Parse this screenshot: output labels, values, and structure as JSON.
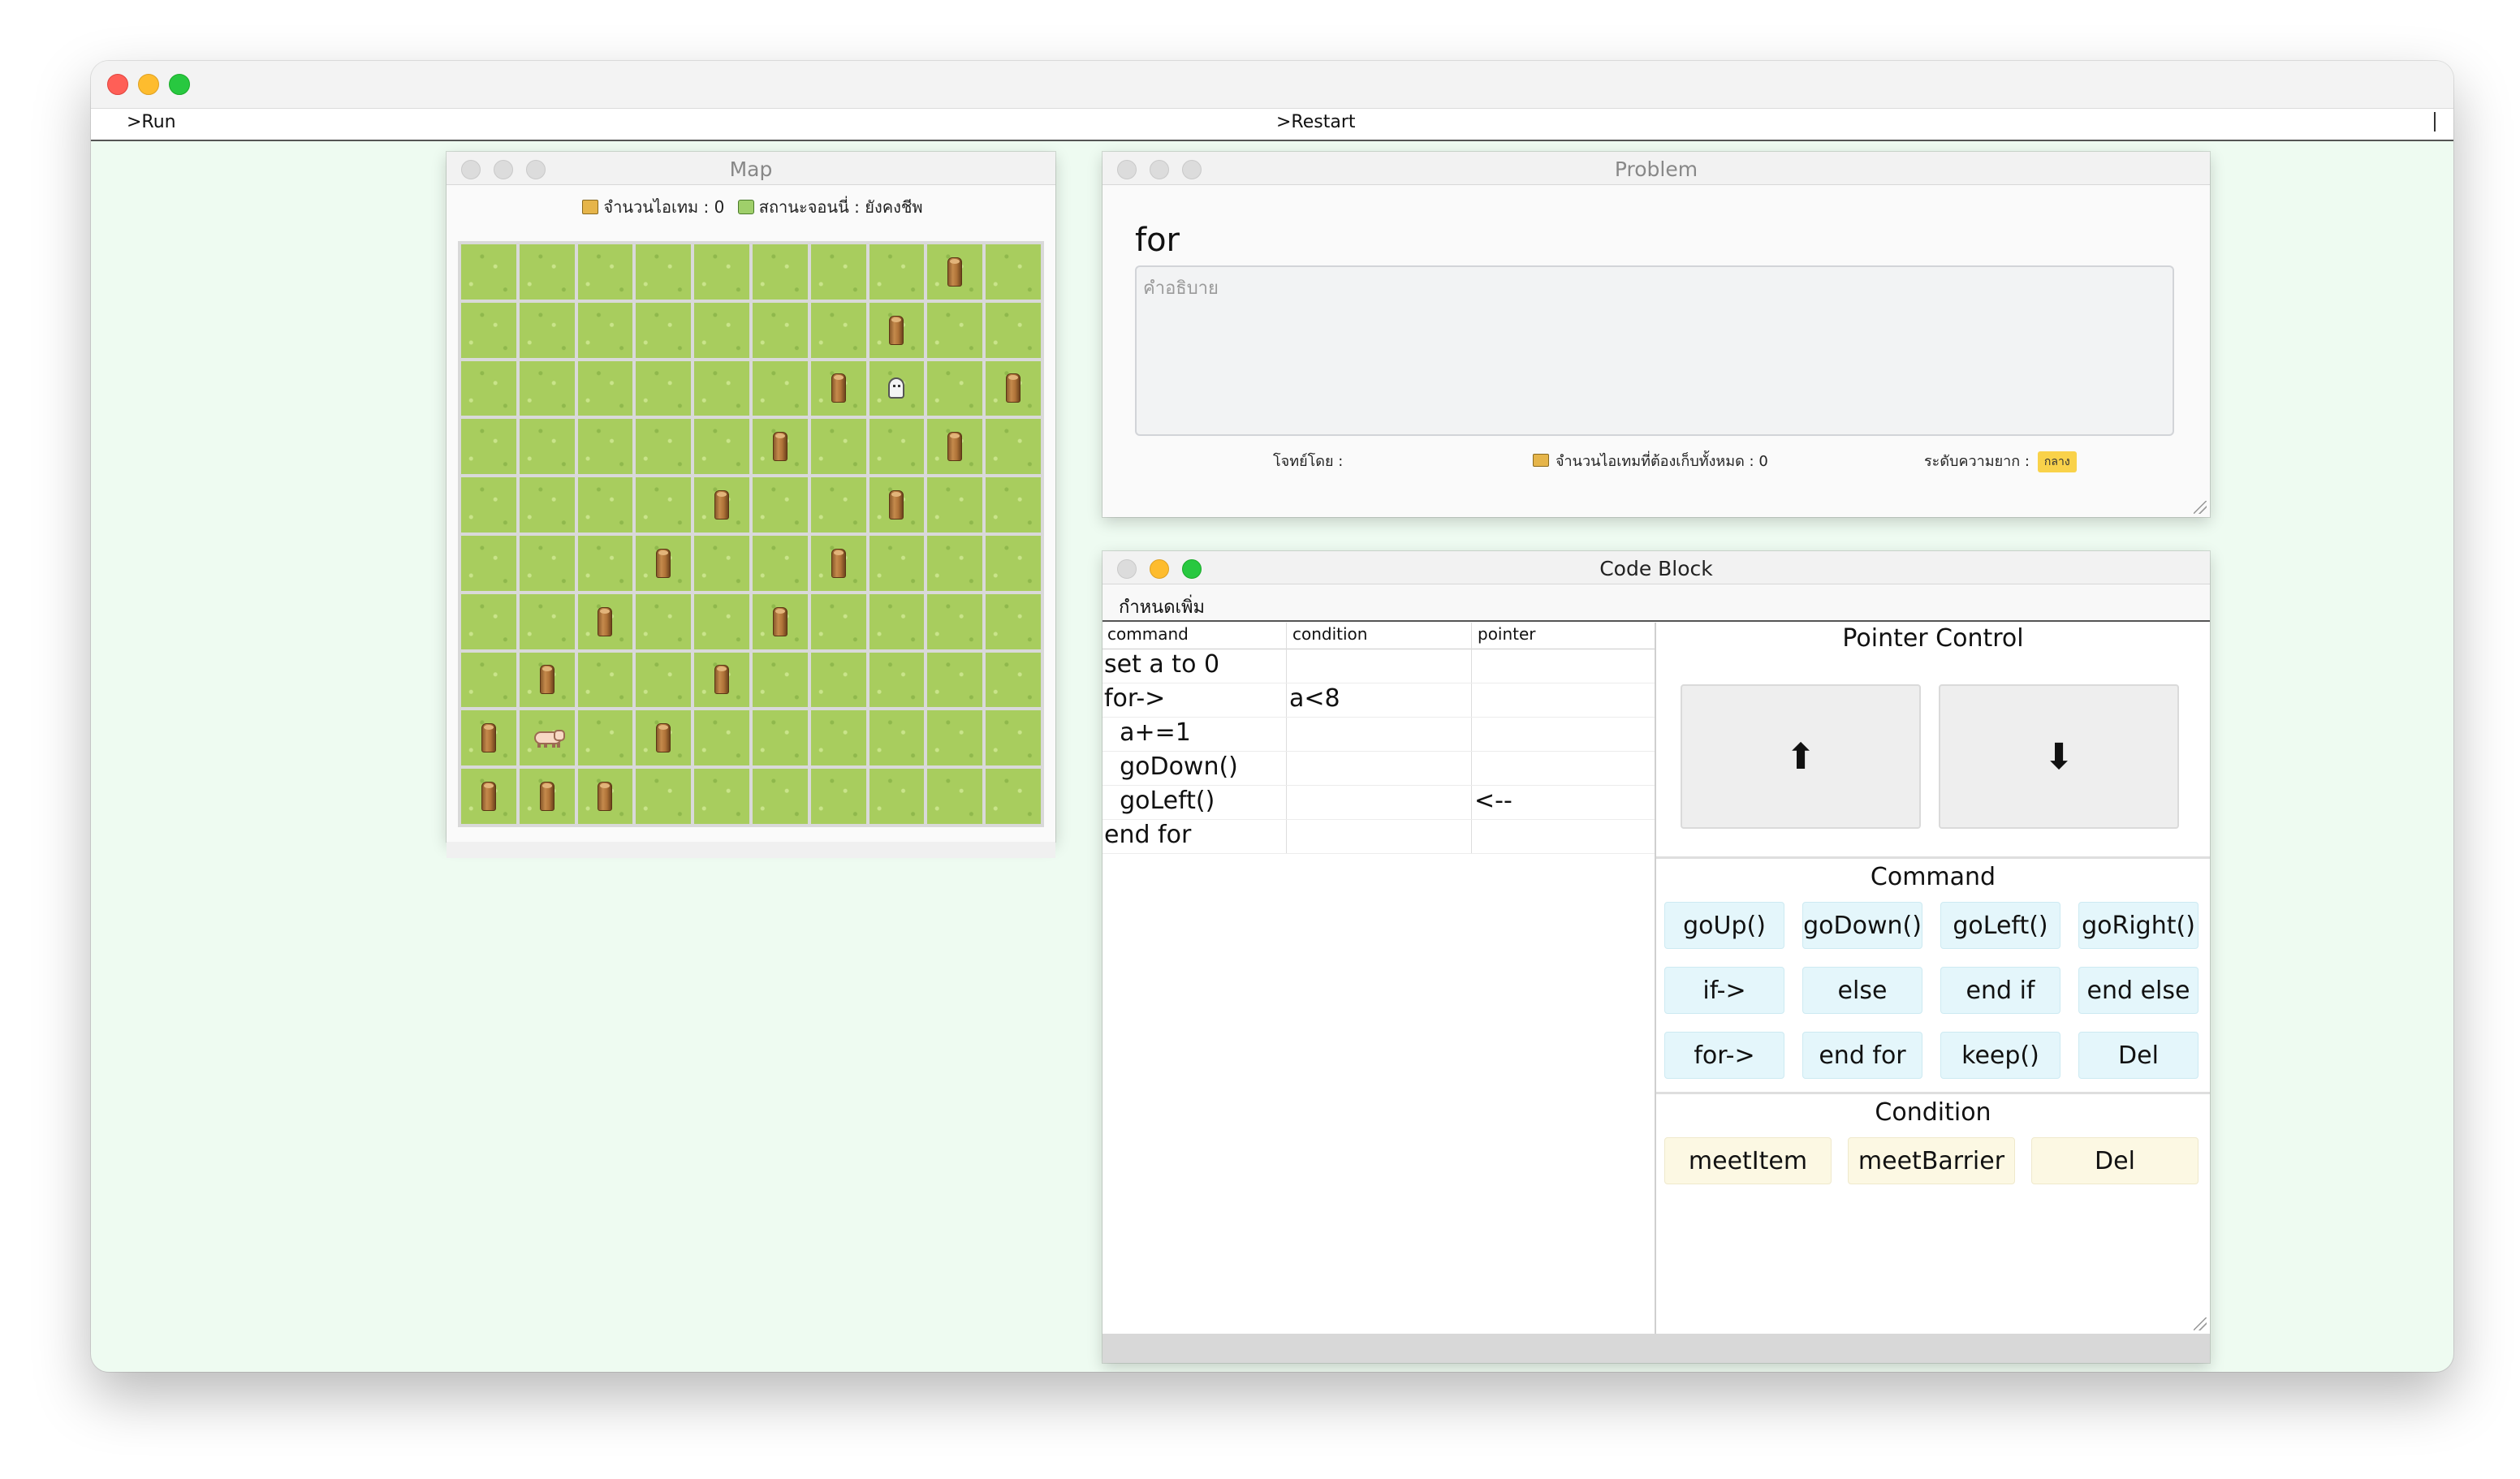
{
  "app": {
    "menu": {
      "run": ">Run",
      "restart": ">Restart"
    }
  },
  "map": {
    "title": "Map",
    "item_count_label": "จำนวนไอเทม : 0",
    "status_label": "สถานะจอนนี่ : ยังคงชีพ",
    "icons": {
      "item": "item-box-icon",
      "status": "status-icon"
    },
    "rows": 10,
    "cols": 10,
    "logs": [
      [
        0,
        8
      ],
      [
        1,
        7
      ],
      [
        2,
        6
      ],
      [
        2,
        9
      ],
      [
        3,
        5
      ],
      [
        3,
        8
      ],
      [
        4,
        4
      ],
      [
        4,
        7
      ],
      [
        5,
        3
      ],
      [
        5,
        6
      ],
      [
        6,
        2
      ],
      [
        6,
        5
      ],
      [
        7,
        1
      ],
      [
        7,
        4
      ],
      [
        8,
        0
      ],
      [
        8,
        3
      ],
      [
        9,
        0
      ],
      [
        9,
        1
      ],
      [
        9,
        2
      ]
    ],
    "character": {
      "name": "ghost",
      "cell": [
        2,
        7
      ]
    },
    "player": {
      "name": "pig",
      "cell": [
        8,
        1
      ]
    }
  },
  "problem": {
    "title": "Problem",
    "name": "for",
    "description_placeholder": "คำอธิบาย",
    "author_label": "โจทย์โดย :",
    "total_items_label": "จำนวนไอเทมที่ต้องเก็บทั้งหมด : 0",
    "difficulty_label": "ระดับความยาก :",
    "difficulty_value": "กลาง",
    "difficulty_color": "#f9d24a"
  },
  "code_block": {
    "title": "Code Block",
    "menu_label": "กำหนดเพิ่ม",
    "headers": {
      "command": "command",
      "condition": "condition",
      "pointer": "pointer"
    },
    "rows": [
      {
        "command": "set a to 0",
        "condition": "",
        "pointer": ""
      },
      {
        "command": "for->",
        "condition": "a<8",
        "pointer": ""
      },
      {
        "command": "  a+=1",
        "condition": "",
        "pointer": ""
      },
      {
        "command": "  goDown()",
        "condition": "",
        "pointer": ""
      },
      {
        "command": "  goLeft()",
        "condition": "",
        "pointer": "<--"
      },
      {
        "command": "end for",
        "condition": "",
        "pointer": ""
      }
    ],
    "pointer_control": {
      "title": "Pointer Control",
      "up": "⬆",
      "down": "⬇"
    },
    "command": {
      "title": "Command",
      "buttons": [
        "goUp()",
        "goDown()",
        "goLeft()",
        "goRight()",
        "if->",
        "else",
        "end if",
        "end else",
        "for->",
        "end for",
        "keep()",
        "Del"
      ]
    },
    "condition": {
      "title": "Condition",
      "buttons": [
        "meetItem",
        "meetBarrier",
        "Del"
      ]
    }
  }
}
